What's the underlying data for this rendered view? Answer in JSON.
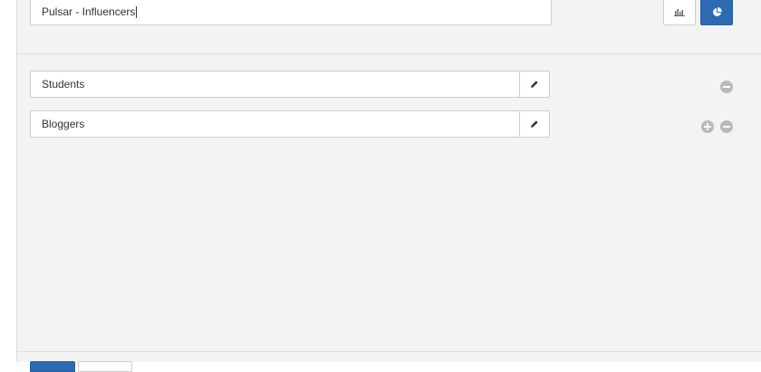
{
  "header": {
    "name_value": "Pulsar - Influencers",
    "bar_view_icon": "bar-chart-icon",
    "pie_view_icon": "pie-chart-icon",
    "accent_color": "#2d6ab4"
  },
  "segments": [
    {
      "label": "Students",
      "edit_icon": "pencil-icon",
      "actions": [
        "remove"
      ]
    },
    {
      "label": "Bloggers",
      "edit_icon": "pencil-icon",
      "actions": [
        "add",
        "remove"
      ]
    }
  ],
  "icons": {
    "add": "plus-circle-icon",
    "remove": "minus-circle-icon"
  }
}
